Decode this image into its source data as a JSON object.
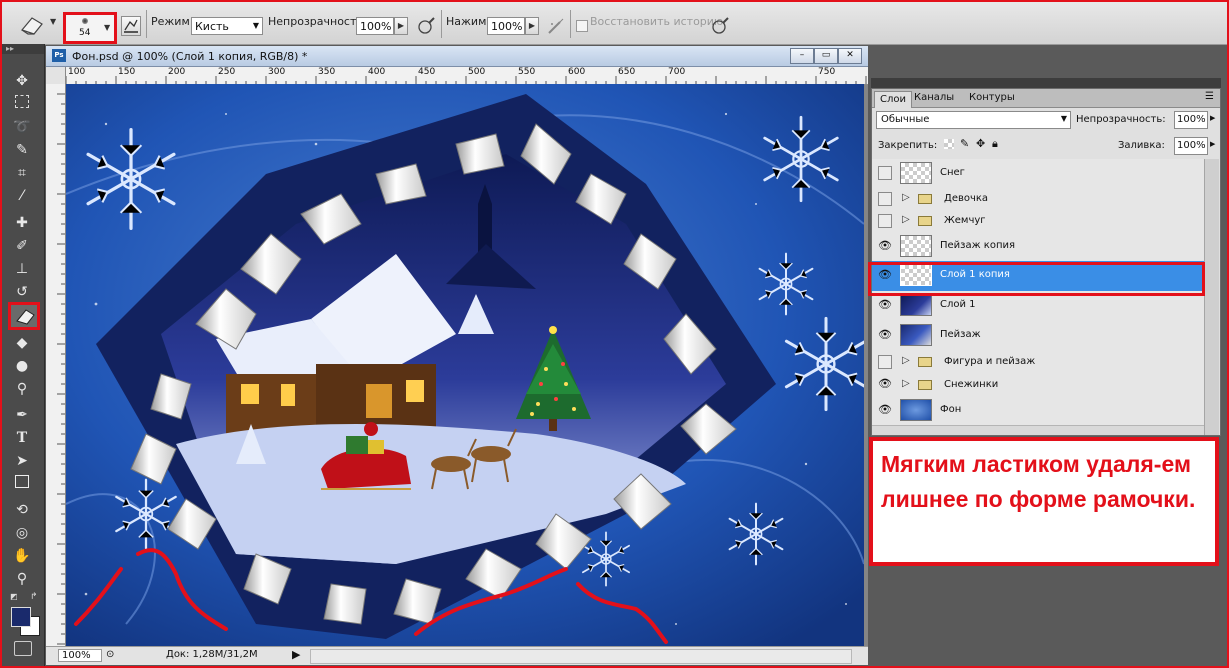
{
  "options_bar": {
    "brush_size": "54",
    "mode_label": "Режим:",
    "mode_value": "Кисть",
    "opacity_label": "Непрозрачность:",
    "opacity_value": "100%",
    "flow_label": "Нажим:",
    "flow_value": "100%",
    "history_label": "Восстановить историю"
  },
  "document": {
    "title": "Фон.psd @ 100% (Слой 1 копия, RGB/8) *",
    "ruler_ticks": [
      "100",
      "150",
      "200",
      "250",
      "300",
      "350",
      "400",
      "450",
      "500",
      "550",
      "600",
      "650",
      "700",
      "750"
    ],
    "zoom": "100%",
    "doc_info": "Док: 1,28M/31,2M"
  },
  "layers_panel": {
    "tabs": [
      "Слои",
      "Каналы",
      "Контуры"
    ],
    "blend_mode": "Обычные",
    "opacity_label": "Непрозрачность:",
    "opacity_value": "100%",
    "lock_label": "Закрепить:",
    "fill_label": "Заливка:",
    "fill_value": "100%",
    "layers": [
      {
        "name": "Снег",
        "visible": false,
        "type": "layer",
        "thumb": "checker"
      },
      {
        "name": "Девочка",
        "visible": false,
        "type": "group"
      },
      {
        "name": "Жемчуг",
        "visible": false,
        "type": "group"
      },
      {
        "name": "Пейзаж копия",
        "visible": true,
        "type": "layer",
        "thumb": "checker"
      },
      {
        "name": "Слой 1 копия",
        "visible": true,
        "type": "layer",
        "thumb": "checker",
        "selected": true
      },
      {
        "name": "Слой 1",
        "visible": true,
        "type": "layer",
        "thumb": "image"
      },
      {
        "name": "Пейзаж",
        "visible": true,
        "type": "layer",
        "thumb": "image"
      },
      {
        "name": "Фигура и пейзаж",
        "visible": false,
        "type": "group"
      },
      {
        "name": "Снежинки",
        "visible": true,
        "type": "group"
      },
      {
        "name": "Фон",
        "visible": true,
        "type": "layer",
        "thumb": "sky"
      }
    ]
  },
  "callout": {
    "text": "Мягким ластиком удаля-ем лишнее по форме рамочки."
  },
  "colors": {
    "accent_red": "#e3101a",
    "selected_layer": "#3a8ee6",
    "canvas_blue": "#1f4fa8",
    "foreground_swatch": "#1a2a6c"
  }
}
